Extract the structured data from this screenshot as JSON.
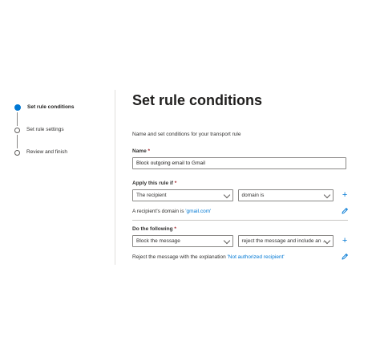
{
  "steps": [
    {
      "label": "Set rule conditions",
      "active": true
    },
    {
      "label": "Set rule settings",
      "active": false
    },
    {
      "label": "Review and finish",
      "active": false
    }
  ],
  "page": {
    "title": "Set rule conditions",
    "subtitle": "Name and set conditions for your transport rule"
  },
  "name_field": {
    "label": "Name",
    "required_mark": "*",
    "value": "Block outgoing email to Gmail"
  },
  "apply_rule": {
    "label": "Apply this rule if",
    "required_mark": "*",
    "condition": "The recipient",
    "qualifier": "domain is",
    "summary_prefix": "A recipient's domain is ",
    "summary_value": "'gmail.com'"
  },
  "do_following": {
    "label": "Do the following",
    "required_mark": "*",
    "action": "Block the message",
    "qualifier": "reject the message and include an ...",
    "summary_prefix": "Reject the message with the explanation ",
    "summary_value": "'Not authorized recipient'"
  },
  "icons": {
    "add": "plus-icon",
    "edit": "pencil-icon",
    "dropdown": "chevron-down-icon"
  },
  "colors": {
    "accent": "#0078d4",
    "required": "#a4262c"
  }
}
